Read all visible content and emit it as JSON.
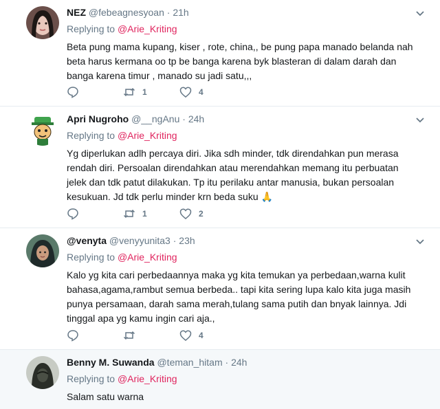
{
  "tweets": [
    {
      "name": "NEZ",
      "handle": "@febeagnesyoan",
      "time": "21h",
      "replying_label": "Replying to",
      "replying_to": "@Arie_Kriting",
      "text": "Beta pung mama kupang, kiser , rote, china,, be pung papa manado belanda nah\nbeta harus kermana oo tp be banga karena byk blasteran di dalam darah dan\nbanga karena timur , manado su jadi satu,,,",
      "retweets": "1",
      "likes": "4"
    },
    {
      "name": "Apri Nugroho",
      "handle": "@__ngAnu",
      "time": "24h",
      "replying_label": "Replying to",
      "replying_to": "@Arie_Kriting",
      "text": "Yg diperlukan adlh percaya diri. Jika sdh minder, tdk direndahkan pun merasa\nrendah diri. Persoalan direndahkan atau merendahkan memang itu perbuatan\njelek dan tdk patut dilakukan. Tp itu perilaku antar manusia, bukan persoalan\nkesukuan. Jd tdk perlu minder krn beda suku",
      "emoji": "🙏",
      "retweets": "1",
      "likes": "2"
    },
    {
      "name": "@venyta",
      "handle": "@venyyunita3",
      "time": "23h",
      "replying_label": "Replying to",
      "replying_to": "@Arie_Kriting",
      "text": "Kalo yg kita cari perbedaannya maka yg kita temukan ya perbedaan,warna kulit\nbahasa,agama,rambut semua berbeda.. tapi kita sering lupa kalo kita juga masih\npunya persamaan, darah sama merah,tulang sama putih dan bnyak lainnya. Jdi\ntinggal apa yg kamu ingin cari aja.,",
      "retweets": "",
      "likes": "4"
    },
    {
      "name": "Benny M. Suwanda",
      "handle": "@teman_hitam",
      "time": "24h",
      "replying_label": "Replying to",
      "replying_to": "@Arie_Kriting",
      "text": "Salam satu warna"
    }
  ],
  "separator": "·",
  "icons": {
    "reply": "reply-icon",
    "retweet": "retweet-icon",
    "like": "heart-icon",
    "more": "chevron-down-icon"
  },
  "colors": {
    "name": "#14171a",
    "secondary": "#657786",
    "mention": "#e0245e",
    "divider": "#e6ecf0",
    "highlight_bg": "#f5f8fa"
  }
}
